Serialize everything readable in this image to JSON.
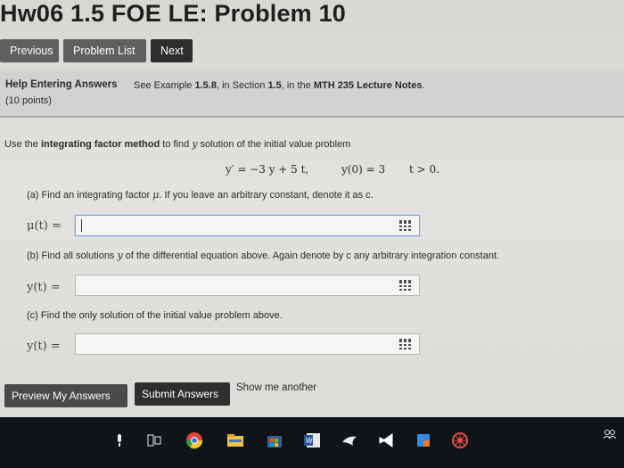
{
  "page": {
    "title": "Hw06 1.5 FOE LE: Problem 10"
  },
  "nav": {
    "previous": "Previous",
    "problem_list": "Problem List",
    "next": "Next"
  },
  "help": {
    "title": "Help Entering Answers",
    "see_prefix": "See Example ",
    "example": "1.5.8",
    "see_mid": ", in Section ",
    "section": "1.5",
    "see_mid2": ", in the ",
    "notes": "MTH 235 Lecture Notes",
    "see_end": ".",
    "points": "(10 points)"
  },
  "problem": {
    "intro_pre": "Use the ",
    "intro_bold": "integrating factor method",
    "intro_mid": " to find ",
    "intro_var": "y",
    "intro_post": " solution of the initial value problem",
    "equation": "y′ = −3 y + 5 t,",
    "initial": "y(0) = 3",
    "domain": "t > 0.",
    "part_a_pre": "(a) Find an integrating factor ",
    "part_a_var": "μ",
    "part_a_post": ". If you leave an arbitrary constant, denote it as c.",
    "label_a": "μ(t) =",
    "part_b_pre": "(b) Find all solutions ",
    "part_b_var": "y",
    "part_b_post": " of the differential equation above. Again denote by c any arbitrary integration constant.",
    "label_b": "y(t) =",
    "part_c": "(c) Find the only solution of the initial value problem above.",
    "label_c": "y(t) ="
  },
  "answers": {
    "mu": "",
    "y_general": "",
    "y_particular": ""
  },
  "buttons": {
    "preview": "Preview My Answers",
    "submit": "Submit Answers",
    "show_another": "Show me another"
  },
  "taskbar": {
    "icons": [
      "mic-icon",
      "task-view-icon",
      "chrome-icon",
      "file-explorer-icon",
      "store-icon",
      "word-icon",
      "bird-icon",
      "visual-studio-icon",
      "blue-app-icon",
      "spider-icon",
      "people-icon"
    ]
  }
}
